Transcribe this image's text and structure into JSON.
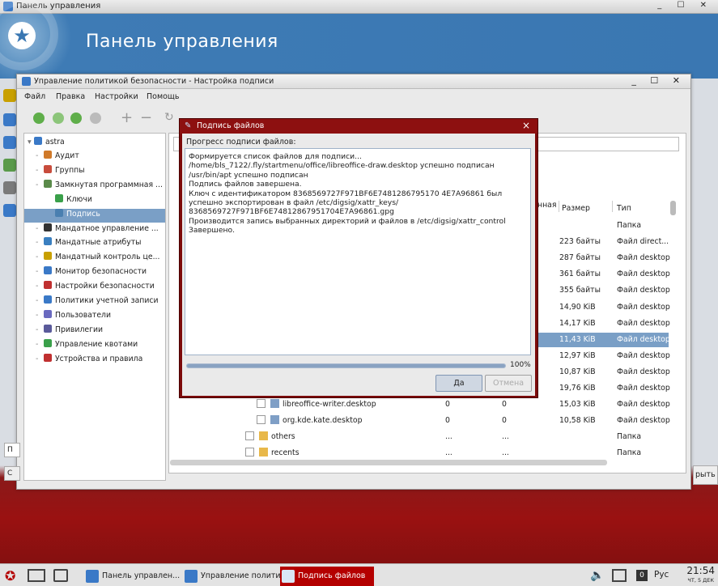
{
  "desktop": {
    "top_title": "Панель управления",
    "header_title": "Панель управления"
  },
  "window": {
    "title": "Управление политикой безопасности - Настройка подписи",
    "menu": [
      "Файл",
      "Правка",
      "Настройки",
      "Помощь"
    ]
  },
  "tree": {
    "root": "astra",
    "items": [
      {
        "label": "Аудит",
        "level": 1,
        "color": "#d07a2a"
      },
      {
        "label": "Группы",
        "level": 1,
        "color": "#c84c3c"
      },
      {
        "label": "Замкнутая программная ...",
        "level": 1,
        "color": "#5a8a4a"
      },
      {
        "label": "Ключи",
        "level": 2,
        "color": "#3aa04a"
      },
      {
        "label": "Подпись",
        "level": 2,
        "color": "#4a7fb0",
        "selected": true
      },
      {
        "label": "Мандатное управление ...",
        "level": 1,
        "color": "#333"
      },
      {
        "label": "Мандатные атрибуты",
        "level": 1,
        "color": "#3a7fc0"
      },
      {
        "label": "Мандатный контроль це...",
        "level": 1,
        "color": "#c8a000"
      },
      {
        "label": "Монитор безопасности",
        "level": 1,
        "color": "#3a79c7"
      },
      {
        "label": "Настройки безопасности",
        "level": 1,
        "color": "#c03030"
      },
      {
        "label": "Политики учетной записи",
        "level": 1,
        "color": "#3a79c7"
      },
      {
        "label": "Пользователи",
        "level": 1,
        "color": "#6a6ac0"
      },
      {
        "label": "Привилегии",
        "level": 1,
        "color": "#5a5a9a"
      },
      {
        "label": "Управление квотами",
        "level": 1,
        "color": "#3aa04a"
      },
      {
        "label": "Устройства и правила",
        "level": 1,
        "color": "#c03030"
      }
    ]
  },
  "table": {
    "headers": {
      "c1": "нная",
      "size": "Размер",
      "type": "Тип"
    },
    "rows": [
      {
        "size": "",
        "type": "Папка"
      },
      {
        "size": "223 байты",
        "type": "Файл direct..."
      },
      {
        "size": "287 байты",
        "type": "Файл desktop"
      },
      {
        "size": "361 байты",
        "type": "Файл desktop"
      },
      {
        "size": "355 байты",
        "type": "Файл desktop"
      },
      {
        "size": "14,90 KiB",
        "type": "Файл desktop"
      },
      {
        "size": "14,17 KiB",
        "type": "Файл desktop"
      },
      {
        "size": "11,43 KiB",
        "type": "Файл desktop",
        "selected": true
      },
      {
        "size": "12,97 KiB",
        "type": "Файл desktop"
      },
      {
        "size": "10,87 KiB",
        "type": "Файл desktop"
      },
      {
        "size": "19,76 KiB",
        "type": "Файл desktop"
      },
      {
        "name": "libreoffice-writer.desktop",
        "a": "0",
        "b": "0",
        "size": "15,03 KiB",
        "type": "Файл desktop"
      },
      {
        "name": "org.kde.kate.desktop",
        "a": "0",
        "b": "0",
        "size": "10,58 KiB",
        "type": "Файл desktop"
      },
      {
        "name": "others",
        "a": "...",
        "b": "...",
        "size": "",
        "type": "Папка",
        "folder": true
      },
      {
        "name": "recents",
        "a": "...",
        "b": "...",
        "size": "",
        "type": "Папка",
        "folder": true
      }
    ]
  },
  "left_buttons": {
    "p": "П",
    "c": "С"
  },
  "right_button": "рыть",
  "dialog": {
    "title": "Подпись файлов",
    "progress_label": "Прогресс подписи файлов:",
    "log": "Формируется список файлов для подписи...\n/home/bls_7122/.fly/startmenu/office/libreoffice-draw.desktop успешно подписан\n/usr/bin/apt успешно подписан\nПодпись файлов завершена.\nКлюч с идентификатором 8368569727F971BF6E7481286795170 4E7A96861 был успешно экспортирован в файл /etc/digsig/xattr_keys/\n8368569727F971BF6E74812867951704E7A96861.gpg\nПроизводится запись выбранных директорий и файлов в /etc/digsig/xattr_control\nЗавершено.",
    "progress": 1.0,
    "progress_text": "100%",
    "ok": "Да",
    "cancel": "Отмена"
  },
  "taskbar": {
    "items": [
      "Панель управлен...",
      "Управление полити...",
      "Подпись файлов"
    ],
    "lang": "Рус",
    "badge": "0",
    "time": "21:54",
    "date": "ЧТ, 5 ДЕК"
  }
}
